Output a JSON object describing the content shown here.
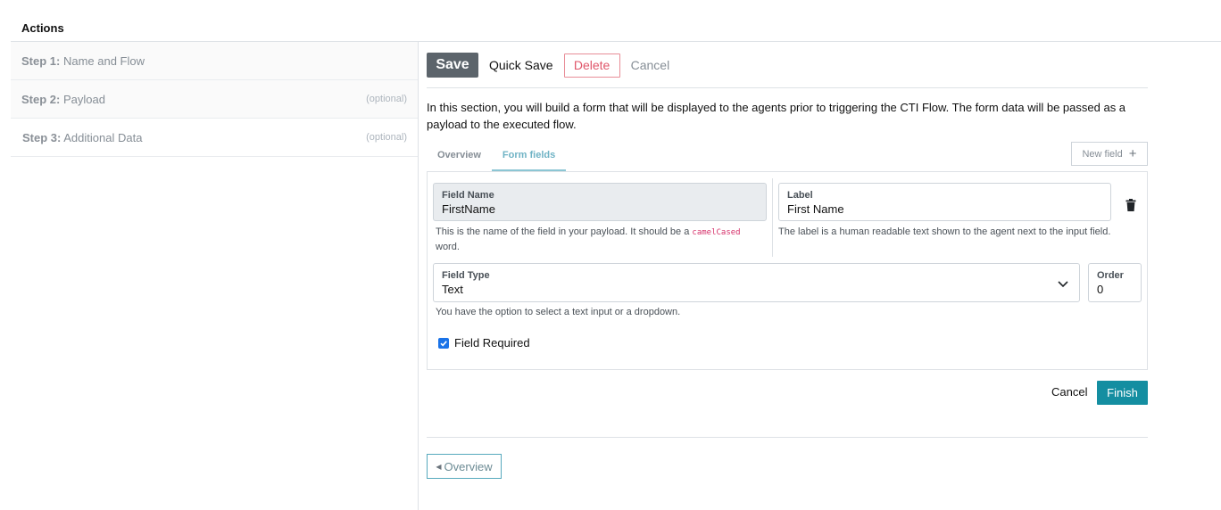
{
  "header": {
    "title": "Actions"
  },
  "sidebar": {
    "steps": [
      {
        "prefix": "Step 1:",
        "label": "Name and Flow",
        "optional": ""
      },
      {
        "prefix": "Step 2:",
        "label": "Payload",
        "optional": "(optional)"
      },
      {
        "prefix": "Step 3:",
        "label": "Additional Data",
        "optional": "(optional)"
      }
    ]
  },
  "toolbar": {
    "save_label": "Save",
    "quick_save_label": "Quick Save",
    "delete_label": "Delete",
    "cancel_label": "Cancel"
  },
  "main": {
    "intro": "In this section, you will build a form that will be displayed to the agents prior to triggering the CTI Flow. The form data will be passed as a payload to the executed flow.",
    "tabs": [
      {
        "label": "Overview",
        "active": false
      },
      {
        "label": "Form fields",
        "active": true
      }
    ],
    "new_field_label": "New field"
  },
  "form": {
    "field_name": {
      "label": "Field Name",
      "value": "FirstName",
      "help_pre": "This is the name of the field in your payload. It should be a ",
      "help_code": "camelCased",
      "help_post": " word."
    },
    "field_label": {
      "label": "Label",
      "value": "First Name",
      "help": "The label is a human readable text shown to the agent next to the input field."
    },
    "field_type": {
      "label": "Field Type",
      "value": "Text",
      "help": "You have the option to select a text input or a dropdown."
    },
    "order": {
      "label": "Order",
      "value": "0"
    },
    "required": {
      "label": "Field Required",
      "checked": true
    }
  },
  "footer": {
    "cancel_label": "Cancel",
    "finish_label": "Finish",
    "overview_label": "Overview"
  },
  "colors": {
    "primary": "#148ea1",
    "save": "#5c646b",
    "danger": "#e0566a",
    "checkbox": "#1a73e8"
  },
  "icons": {
    "trash": "trash-icon",
    "chevron": "chevron-down-icon",
    "plus": "plus-icon",
    "caret": "caret-left-icon",
    "check": "check-icon"
  }
}
